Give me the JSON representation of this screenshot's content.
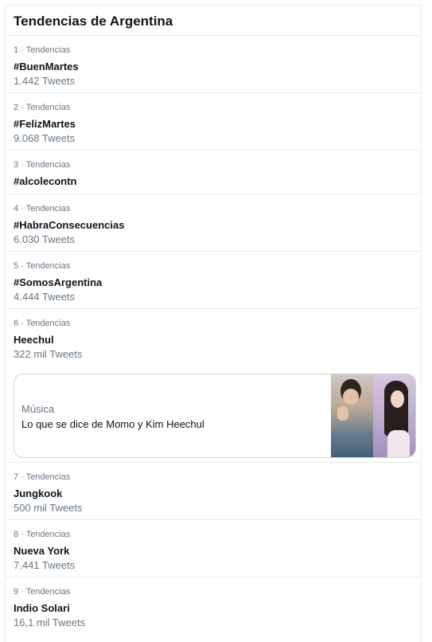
{
  "header": {
    "title": "Tendencias de Argentina"
  },
  "trends": [
    {
      "meta": "1 · Tendencias",
      "name": "#BuenMartes",
      "count": "1.442 Tweets"
    },
    {
      "meta": "2 · Tendencias",
      "name": "#FelizMartes",
      "count": "9.068 Tweets"
    },
    {
      "meta": "3 · Tendencias",
      "name": "#alcolecontn",
      "count": ""
    },
    {
      "meta": "4 · Tendencias",
      "name": "#HabraConsecuencias",
      "count": "6.030 Tweets"
    },
    {
      "meta": "5 · Tendencias",
      "name": "#SomosArgentina",
      "count": "4.444 Tweets"
    },
    {
      "meta": "6 · Tendencias",
      "name": "Heechul",
      "count": "322 mil Tweets",
      "card": {
        "category": "Música",
        "title": "Lo que se dice de Momo y Kim Heechul",
        "image": "photo-collage"
      }
    },
    {
      "meta": "7 · Tendencias",
      "name": "Jungkook",
      "count": "500 mil Tweets"
    },
    {
      "meta": "8 · Tendencias",
      "name": "Nueva York",
      "count": "7.441 Tweets"
    },
    {
      "meta": "9 · Tendencias",
      "name": "Indio Solari",
      "count": "16,1 mil Tweets"
    }
  ],
  "colors": {
    "secondary_text": "#657786",
    "divider": "#e6ecf0",
    "primary_text": "#0f1419"
  }
}
